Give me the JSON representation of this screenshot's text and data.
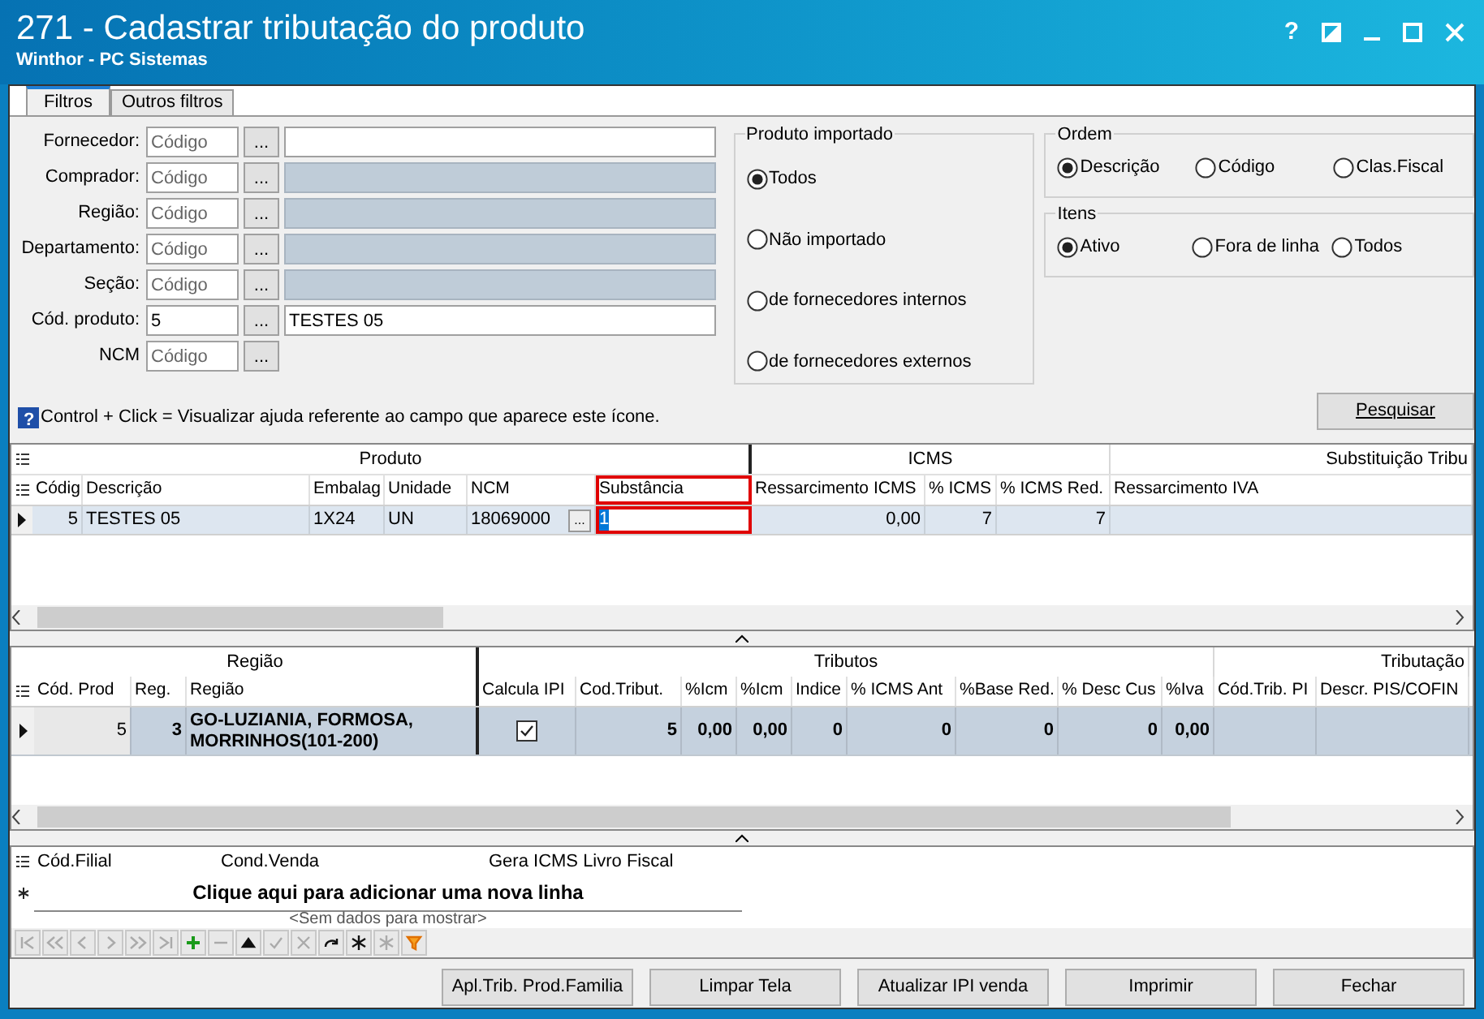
{
  "window": {
    "title": "271 - Cadastrar tributação do produto",
    "subtitle": "Winthor - PC Sistemas",
    "help_glyph": "?"
  },
  "tabs": [
    {
      "label": "Filtros",
      "selected": true
    },
    {
      "label": "Outros filtros",
      "selected": false
    }
  ],
  "filters": [
    {
      "label": "Fornecedor:",
      "code": {
        "placeholder": "Código"
      },
      "description": {
        "disabled": false
      }
    },
    {
      "label": "Comprador:",
      "code": {
        "placeholder": "Código"
      },
      "description": {
        "disabled": true
      }
    },
    {
      "label": "Região:",
      "code": {
        "placeholder": "Código"
      },
      "description": {
        "disabled": true
      }
    },
    {
      "label": "Departamento:",
      "code": {
        "placeholder": "Código"
      },
      "description": {
        "disabled": true
      }
    },
    {
      "label": "Seção:",
      "code": {
        "placeholder": "Código"
      },
      "description": {
        "disabled": true
      }
    },
    {
      "label": "Cód. produto:",
      "code": {
        "value": "5"
      },
      "description": {
        "disabled": false,
        "value": "TESTES 05"
      }
    },
    {
      "label": "NCM",
      "code": {
        "placeholder": "Código"
      }
    }
  ],
  "lookup_button": "...",
  "produto_importado": {
    "title": "Produto importado",
    "options": [
      {
        "label": "Todos",
        "selected": true
      },
      {
        "label": "Não importado",
        "selected": false
      },
      {
        "label": "de fornecedores internos",
        "selected": false
      },
      {
        "label": "de fornecedores externos",
        "selected": false
      }
    ]
  },
  "ordem": {
    "title": "Ordem",
    "options": [
      {
        "label": "Descrição",
        "selected": true
      },
      {
        "label": "Código",
        "selected": false
      },
      {
        "label": "Clas.Fiscal",
        "selected": false
      }
    ]
  },
  "itens": {
    "title": "Itens",
    "options": [
      {
        "label": "Ativo",
        "selected": true
      },
      {
        "label": "Fora de linha",
        "selected": false
      },
      {
        "label": "Todos",
        "selected": false
      }
    ]
  },
  "help_note": "Control + Click = Visualizar ajuda referente ao campo que aparece este ícone.",
  "search_button": "Pesquisar",
  "grid_produto": {
    "bands": [
      {
        "label": "Produto"
      },
      {
        "label": "ICMS"
      },
      {
        "label": "Substituição Tribu"
      }
    ],
    "columns": [
      {
        "label": "Códig",
        "highlighted": false
      },
      {
        "label": "Descrição",
        "highlighted": false
      },
      {
        "label": "Embalag",
        "highlighted": false
      },
      {
        "label": "Unidade",
        "highlighted": false
      },
      {
        "label": "NCM",
        "highlighted": false
      },
      {
        "label": "Substância",
        "highlighted": true
      },
      {
        "label": "Ressarcimento ICMS",
        "highlighted": false
      },
      {
        "label": "% ICMS",
        "highlighted": false
      },
      {
        "label": "% ICMS Red.",
        "highlighted": false
      },
      {
        "label": "Ressarcimento IVA",
        "highlighted": false
      }
    ],
    "rows": [
      {
        "selected": true,
        "cells": [
          "5",
          "TESTES 05",
          "1X24",
          "UN",
          "18069000",
          "1",
          "0,00",
          "7",
          "7",
          ""
        ]
      }
    ]
  },
  "grid_regiao": {
    "bands": [
      {
        "label": "Região"
      },
      {
        "label": "Tributos"
      },
      {
        "label": "Tributação"
      }
    ],
    "columns": [
      "Cód. Prod",
      "Reg.",
      "Região",
      "Calcula IPI",
      "Cod.Tribut.",
      "%Icm",
      "%Icm",
      "Indice",
      "% ICMS Ant",
      "%Base Red.",
      "% Desc Cus",
      "%Iva",
      "Cód.Trib. PI",
      "Descr. PIS/COFIN"
    ],
    "rows": [
      {
        "selected": true,
        "calcula_ipi": true,
        "cells": [
          "5",
          "3",
          "GO-LUZIANIA, FORMOSA, MORRINHOS(101-200)",
          "",
          "5",
          "0,00",
          "0,00",
          "0",
          "0",
          "0",
          "0",
          "0,00",
          "",
          ""
        ]
      }
    ]
  },
  "grid_filial": {
    "columns": [
      "Cód.Filial",
      "Cond.Venda",
      "Gera ICMS Livro Fiscal"
    ],
    "new_row_prompt": "Clique aqui para adicionar uma nova linha",
    "empty_text": "<Sem dados para mostrar>"
  },
  "buttons": [
    "Apl.Trib. Prod.Familia",
    "Limpar Tela",
    "Atualizar IPI venda",
    "Imprimir",
    "Fechar"
  ]
}
